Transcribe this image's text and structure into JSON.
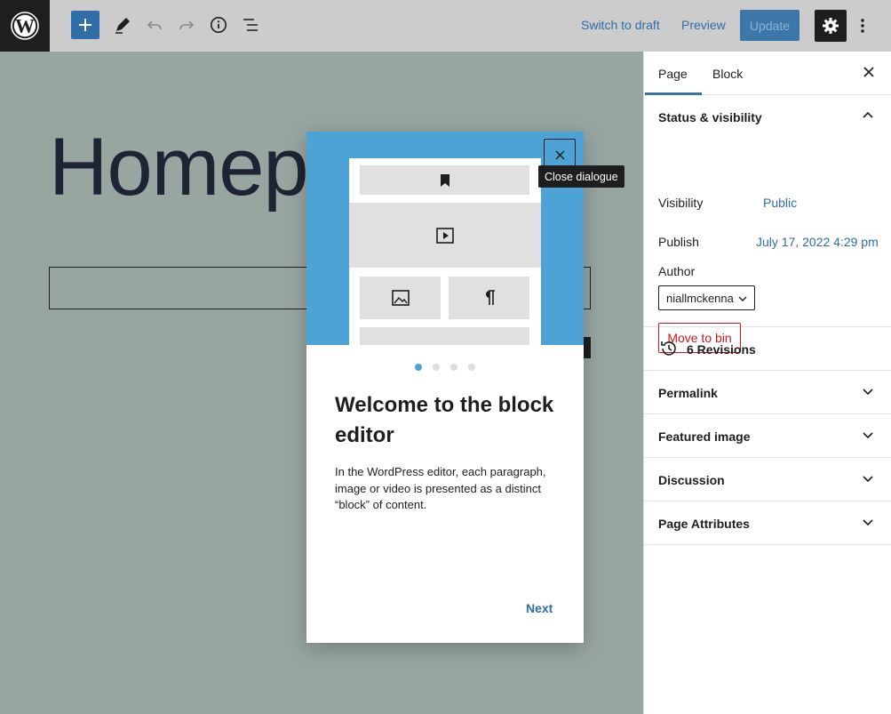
{
  "toolbar": {
    "logo_icon": "wordpress-logo",
    "add_block_icon": "plus-icon",
    "tools_icon": "pencil-icon",
    "undo_icon": "undo-icon",
    "redo_icon": "redo-icon",
    "details_icon": "info-icon",
    "list_view_icon": "list-view-icon",
    "switch_to_draft": "Switch to draft",
    "preview": "Preview",
    "update": "Update",
    "settings_icon": "gear-icon",
    "more_icon": "more-vertical-icon"
  },
  "canvas": {
    "page_title": "Homep"
  },
  "sidebar": {
    "tabs": [
      {
        "label": "Page",
        "active": true
      },
      {
        "label": "Block",
        "active": false
      }
    ],
    "close_icon": "close-icon",
    "status": {
      "heading": "Status & visibility",
      "visibility_label": "Visibility",
      "visibility_value": "Public",
      "publish_label": "Publish",
      "publish_value": "July 17, 2022 4:29 pm",
      "author_label": "Author",
      "author_value": "niallmckenna",
      "move_to_bin": "Move to bin"
    },
    "revisions": "6 Revisions",
    "panels": [
      {
        "label": "Permalink"
      },
      {
        "label": "Featured image"
      },
      {
        "label": "Discussion"
      },
      {
        "label": "Page Attributes"
      }
    ]
  },
  "modal": {
    "title": "Welcome to the block editor",
    "body": "In the WordPress editor, each paragraph, image or video is presented as a distinct “block” of content.",
    "next": "Next",
    "page_count": 4,
    "current_page": 1,
    "close_tooltip": "Close dialogue"
  },
  "colors": {
    "accent": "#2f6ea8",
    "illustration_bg": "#4ea3d6",
    "canvas_overlay": "#98a6a2",
    "danger": "#cc1818"
  }
}
